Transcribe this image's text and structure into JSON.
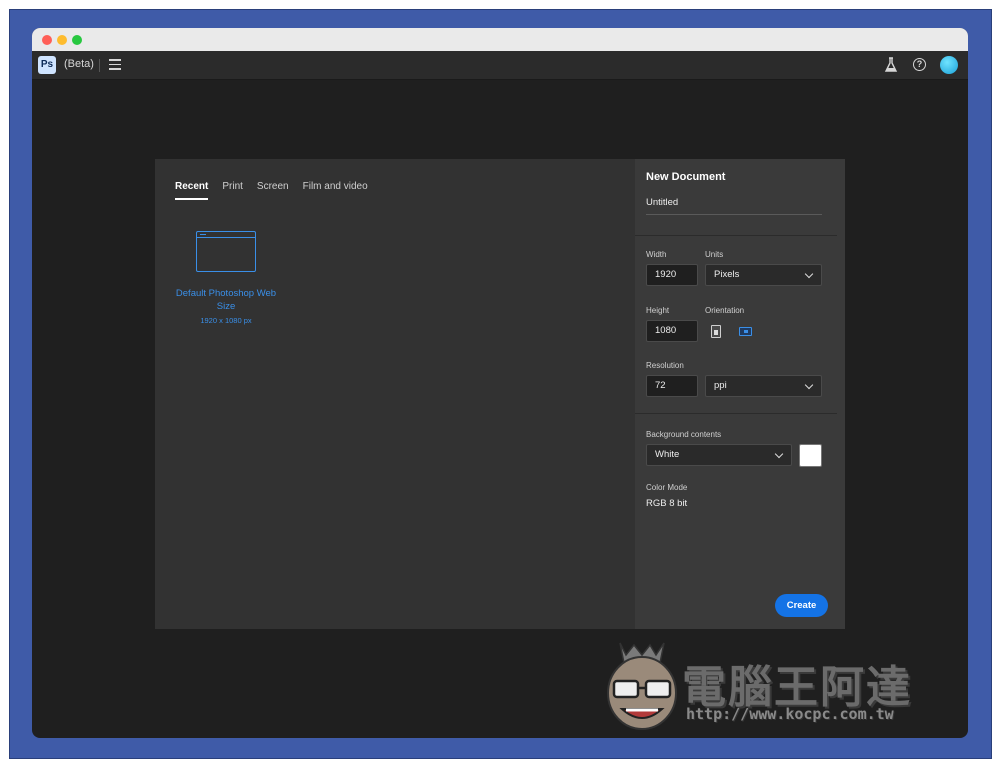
{
  "app": {
    "beta_label": "(Beta)",
    "logo_text": "Ps",
    "help_glyph": "?"
  },
  "tabs": [
    {
      "label": "Recent",
      "active": true
    },
    {
      "label": "Print",
      "active": false
    },
    {
      "label": "Screen",
      "active": false
    },
    {
      "label": "Film and video",
      "active": false
    }
  ],
  "preset": {
    "name": "Default Photoshop Web Size",
    "size": "1920 x 1080 px"
  },
  "new_document": {
    "title": "New Document",
    "name": "Untitled",
    "width_label": "Width",
    "width_value": "1920",
    "units_label": "Units",
    "units_value": "Pixels",
    "height_label": "Height",
    "height_value": "1080",
    "orientation_label": "Orientation",
    "orientation_selected": "landscape",
    "resolution_label": "Resolution",
    "resolution_value": "72",
    "resolution_unit": "ppi",
    "background_label": "Background contents",
    "background_value": "White",
    "background_swatch": "#ffffff",
    "color_mode_label": "Color Mode",
    "color_mode_value": "RGB 8 bit",
    "create_label": "Create"
  },
  "watermark": {
    "title": "電腦王阿達",
    "url": "http://www.kocpc.com.tw"
  },
  "colors": {
    "accent": "#1473e6",
    "link": "#3a8fe8",
    "frame": "#3f5ba8"
  }
}
